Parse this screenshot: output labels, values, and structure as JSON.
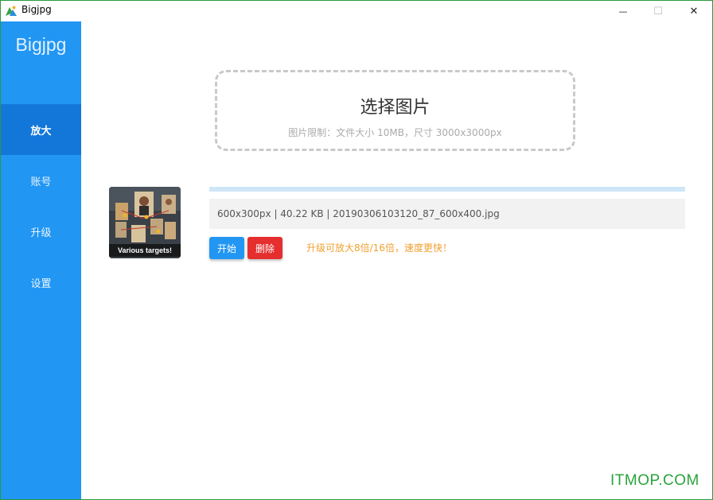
{
  "window": {
    "title": "Bigjpg",
    "controls": {
      "minimize": "—",
      "maximize": "☐",
      "close": "✕"
    }
  },
  "sidebar": {
    "brand": "Bigjpg",
    "items": [
      {
        "label": "放大",
        "active": true
      },
      {
        "label": "账号",
        "active": false
      },
      {
        "label": "升级",
        "active": false
      },
      {
        "label": "设置",
        "active": false
      }
    ]
  },
  "upload": {
    "title": "选择图片",
    "hint": "图片限制：文件大小 10MB，尺寸 3000x3000px"
  },
  "task": {
    "thumbnail_caption": "Various targets!",
    "progress": 0,
    "file_info": "600x300px | 40.22 KB | 20190306103120_87_600x400.jpg",
    "start_label": "开始",
    "delete_label": "删除",
    "upgrade_tip": "升级可放大8倍/16倍，速度更快！"
  },
  "watermark": "ITMOP.COM",
  "colors": {
    "sidebar": "#2196f3",
    "sidebar_active": "#1377d9",
    "start_button": "#2196f3",
    "delete_button": "#e52e2e",
    "upgrade_tip": "#f0a030",
    "watermark": "#2aa33a"
  }
}
